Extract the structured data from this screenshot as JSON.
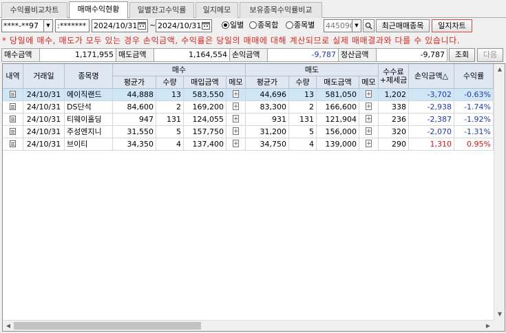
{
  "tabs": [
    {
      "label": "수익률비교차트"
    },
    {
      "label": "매매수익현황"
    },
    {
      "label": "일별잔고수익률"
    },
    {
      "label": "일지메모"
    },
    {
      "label": "보유종목수익률비교"
    }
  ],
  "toolbar": {
    "account_value": "****-**97",
    "password_value": ":*******",
    "date_from": "2024/10/31",
    "date_to": "2024/10/31",
    "date_sep": "~",
    "radio_daily": "일별",
    "radio_sum": "종목합",
    "radio_by_item": "종목별",
    "item_code_value": "445090",
    "recent_button": "최근매매종목",
    "journal_chart_button": "일지차트"
  },
  "notice": "* 당일에 매수, 매도가 모두 있는 경우 손익금액, 수익률은 당일의 매매에 대해 계산되므로 실제 매매결과와 다를 수 있습니다.",
  "summary": {
    "buy_label": "매수금액",
    "buy_value": "1,171,955",
    "sell_label": "매도금액",
    "sell_value": "1,164,554",
    "pnl_label": "손익금액",
    "pnl_value": "-9,787",
    "settle_label": "정산금액",
    "settle_value": "-9,787",
    "query_button": "조회",
    "next_button": "다음"
  },
  "grid": {
    "headers": {
      "detail": "내역",
      "date": "거래일",
      "name": "종목명",
      "buy_group": "매수",
      "sell_group": "매도",
      "fee": "수수료\n+제세금",
      "pnl": "손익금액△",
      "rate": "수익률",
      "buy_avg": "평균가",
      "buy_qty": "수량",
      "buy_amt": "매입금액",
      "buy_memo": "메모",
      "sell_avg": "평균가",
      "sell_qty": "수량",
      "sell_amt": "매도금액",
      "sell_memo": "메모"
    },
    "rows": [
      {
        "date": "24/10/31",
        "name": "에이직랜드",
        "buy_avg": "44,888",
        "buy_qty": "13",
        "buy_amt": "583,550",
        "sell_avg": "44,696",
        "sell_qty": "13",
        "sell_amt": "581,050",
        "fee": "1,202",
        "pnl": "-3,702",
        "rate": "-0.63%",
        "sign": "neg"
      },
      {
        "date": "24/10/31",
        "name": "DS단석",
        "buy_avg": "84,600",
        "buy_qty": "2",
        "buy_amt": "169,200",
        "sell_avg": "83,300",
        "sell_qty": "2",
        "sell_amt": "166,600",
        "fee": "338",
        "pnl": "-2,938",
        "rate": "-1.74%",
        "sign": "neg"
      },
      {
        "date": "24/10/31",
        "name": "티웨이홀딩",
        "buy_avg": "947",
        "buy_qty": "131",
        "buy_amt": "124,055",
        "sell_avg": "931",
        "sell_qty": "131",
        "sell_amt": "121,904",
        "fee": "236",
        "pnl": "-2,387",
        "rate": "-1.92%",
        "sign": "neg"
      },
      {
        "date": "24/10/31",
        "name": "주성엔지니",
        "buy_avg": "31,550",
        "buy_qty": "5",
        "buy_amt": "157,750",
        "sell_avg": "31,200",
        "sell_qty": "5",
        "sell_amt": "156,000",
        "fee": "320",
        "pnl": "-2,070",
        "rate": "-1.31%",
        "sign": "neg"
      },
      {
        "date": "24/10/31",
        "name": "브이티",
        "buy_avg": "34,350",
        "buy_qty": "4",
        "buy_amt": "137,400",
        "sell_avg": "34,750",
        "sell_qty": "4",
        "sell_amt": "139,000",
        "fee": "290",
        "pnl": "1,310",
        "rate": "0.95%",
        "sign": "pos"
      }
    ]
  },
  "colors": {
    "negative": "#1d37c8",
    "positive": "#e30f0f",
    "notice": "#e1261c",
    "selected_row": "#cfe6f7",
    "header_bg": "#dfe7f3"
  }
}
